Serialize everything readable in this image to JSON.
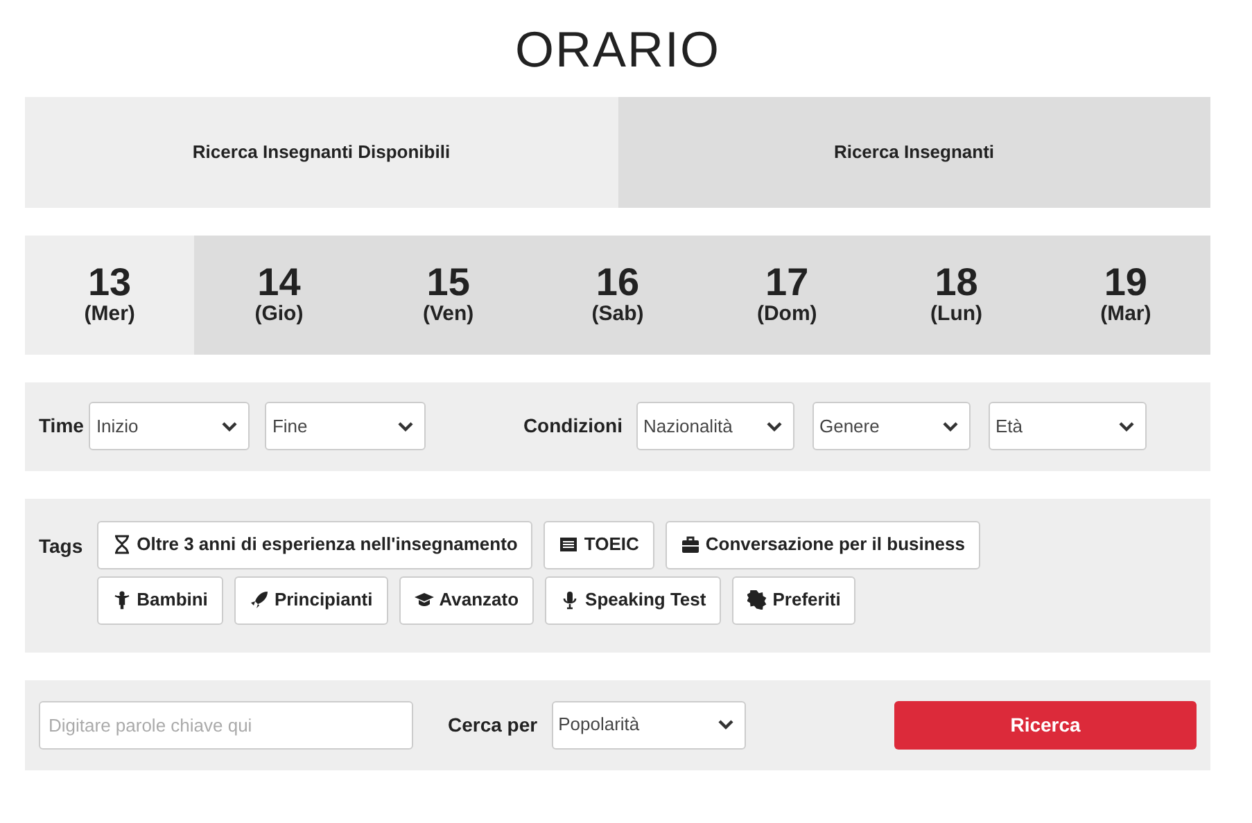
{
  "title": "ORARIO",
  "tabs": [
    {
      "label": "Ricerca Insegnanti Disponibili",
      "selected": true
    },
    {
      "label": "Ricerca Insegnanti",
      "selected": false
    }
  ],
  "days": [
    {
      "number": "13",
      "weekday": "(Mer)",
      "selected": true
    },
    {
      "number": "14",
      "weekday": "(Gio)",
      "selected": false
    },
    {
      "number": "15",
      "weekday": "(Ven)",
      "selected": false
    },
    {
      "number": "16",
      "weekday": "(Sab)",
      "selected": false
    },
    {
      "number": "17",
      "weekday": "(Dom)",
      "selected": false
    },
    {
      "number": "18",
      "weekday": "(Lun)",
      "selected": false
    },
    {
      "number": "19",
      "weekday": "(Mar)",
      "selected": false
    }
  ],
  "filters": {
    "time_label": "Time",
    "time_selects": [
      "Inizio",
      "Fine"
    ],
    "conditions_label": "Condizioni",
    "condition_selects": [
      "Nazionalità",
      "Genere",
      "Età"
    ]
  },
  "tags": {
    "label": "Tags",
    "items": [
      "Oltre 3 anni di esperienza nell'insegnamento",
      "TOEIC",
      "Conversazione per il business",
      "Bambini",
      "Principianti",
      "Avanzato",
      "Speaking Test",
      "Preferiti"
    ]
  },
  "search": {
    "placeholder": "Digitare parole chiave qui",
    "sort_label": "Cerca per",
    "sort_value": "Popolarità",
    "button": "Ricerca"
  }
}
